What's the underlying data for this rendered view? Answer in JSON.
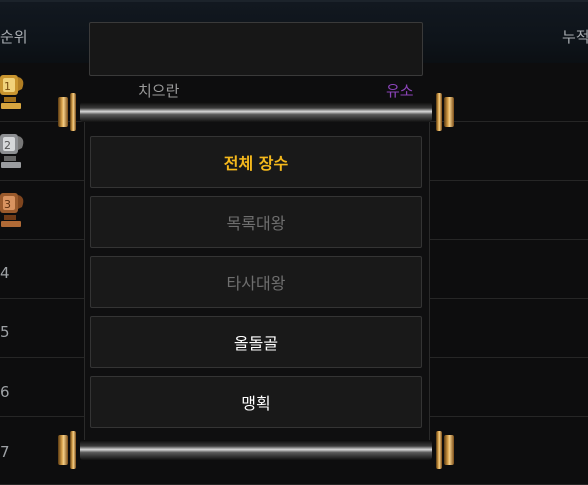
{
  "table": {
    "header": {
      "rank_label": "순위",
      "total_label": "누적"
    },
    "rows": [
      {
        "rank": "1",
        "trophy": "gold-trophy-icon"
      },
      {
        "rank": "2",
        "trophy": "silver-trophy-icon"
      },
      {
        "rank": "3",
        "trophy": "bronze-trophy-icon"
      },
      {
        "rank": "4"
      },
      {
        "rank": "5"
      },
      {
        "rank": "6"
      },
      {
        "rank": "7"
      }
    ],
    "first_row_name": "치으란",
    "first_row_tag": "유소"
  },
  "popup": {
    "search_value": "",
    "options": [
      {
        "label": "전체 장수",
        "state": "selected"
      },
      {
        "label": "목록대왕",
        "state": "disabled"
      },
      {
        "label": "타사대왕",
        "state": "disabled"
      },
      {
        "label": "올돌골",
        "state": "enabled"
      },
      {
        "label": "맹획",
        "state": "enabled"
      }
    ]
  },
  "colors": {
    "selected": "#f4b81c",
    "disabled": "#6e6e6e",
    "enabled": "#ffffff",
    "tag": "#8a43b8"
  }
}
